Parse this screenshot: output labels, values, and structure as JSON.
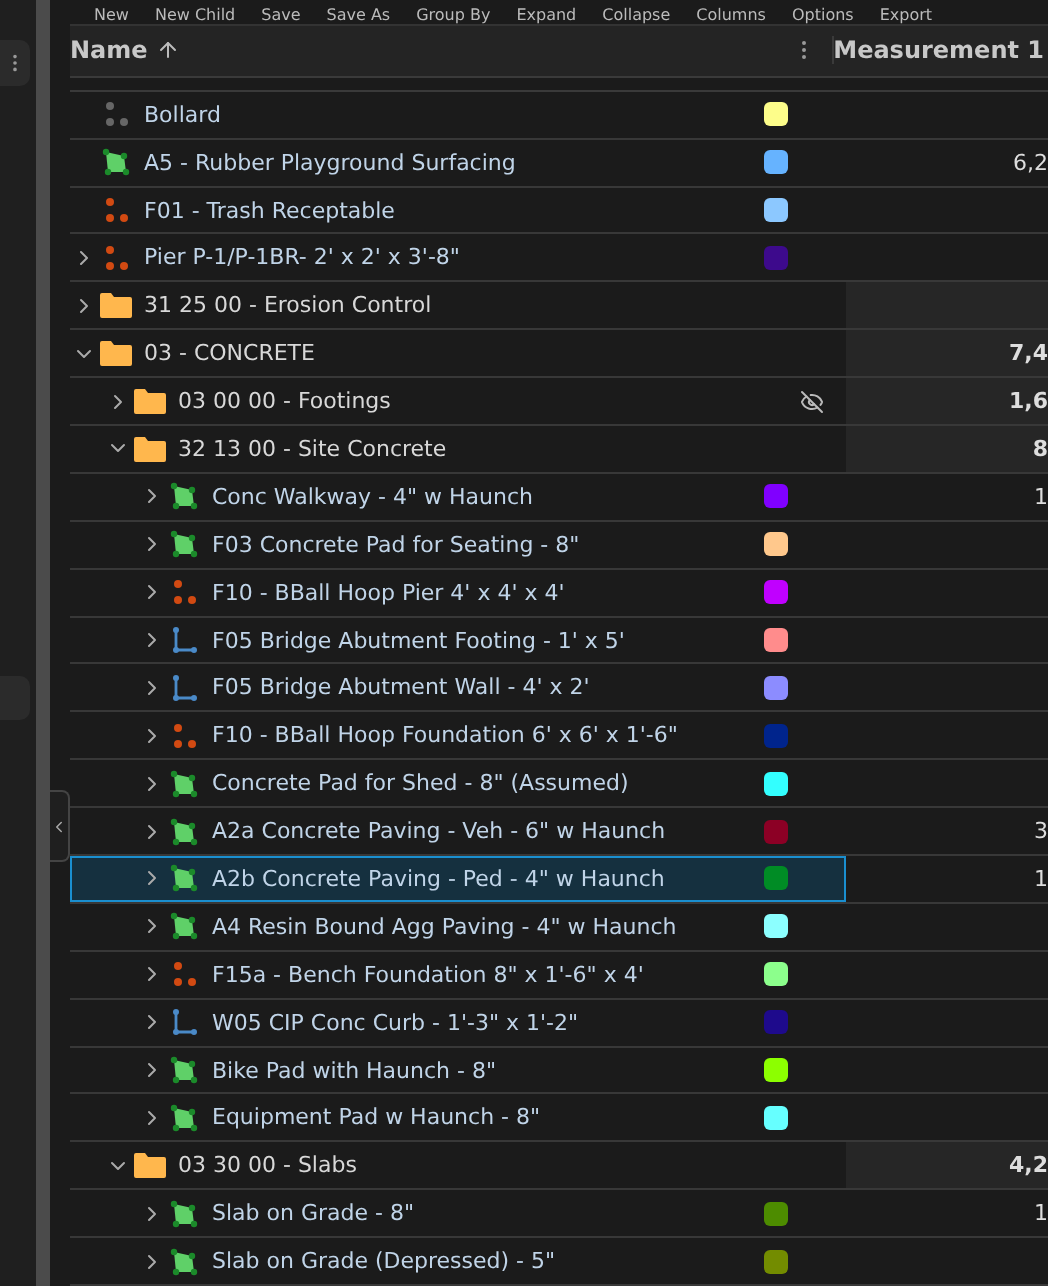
{
  "toolbar": [
    "New",
    "New Child",
    "Save",
    "Save As",
    "Group By",
    "Expand",
    "Collapse",
    "Columns",
    "Options",
    "Export"
  ],
  "columns": [
    {
      "label": "Name"
    },
    {
      "label": "Measurement 1"
    }
  ],
  "rows": [
    {
      "name": "Bollard",
      "kind": "points-muted",
      "color": "#fdfd8a",
      "hidden": false,
      "selected": false
    },
    {
      "name": "A5 - Rubber Playground Surfacing",
      "kind": "area",
      "color": "#66b3ff",
      "measurement": "6,2",
      "hidden": false,
      "selected": false
    },
    {
      "name": "F01 - Trash Receptable",
      "kind": "points",
      "color": "#8cc8ff",
      "hidden": false,
      "selected": false
    },
    {
      "name": "Pier P-1/P-1BR- 2' x 2' x 3'-8\"",
      "kind": "points",
      "color": "#3d0a8c",
      "expanded": false,
      "hidden": false,
      "selected": false
    },
    {
      "name": "31 25 00 - Erosion Control",
      "kind": "folder",
      "expanded": false,
      "hidden": false,
      "selected": false
    },
    {
      "name": "03 - CONCRETE",
      "kind": "folder",
      "measurement": "7,4",
      "expanded": true,
      "hidden": false,
      "selected": false,
      "children": [
        {
          "name": "03 00 00 - Footings",
          "kind": "folder",
          "measurement": "1,6",
          "expanded": false,
          "hidden": true,
          "selected": false
        },
        {
          "name": "32 13 00 - Site Concrete",
          "kind": "folder",
          "measurement": "8",
          "expanded": true,
          "hidden": false,
          "selected": false,
          "children": [
            {
              "name": "Conc Walkway - 4\" w Haunch",
              "kind": "area",
              "color": "#8000ff",
              "measurement": "1",
              "expanded": false,
              "hidden": false,
              "selected": false
            },
            {
              "name": "F03 Concrete Pad for Seating - 8\"",
              "kind": "area",
              "color": "#ffc88c",
              "expanded": false,
              "hidden": false,
              "selected": false
            },
            {
              "name": "F10 - BBall Hoop Pier 4' x 4' x 4'",
              "kind": "points",
              "color": "#c000ff",
              "expanded": false,
              "hidden": false,
              "selected": false
            },
            {
              "name": "F05 Bridge Abutment Footing - 1' x 5'",
              "kind": "line",
              "color": "#ff8c8c",
              "expanded": false,
              "hidden": false,
              "selected": false
            },
            {
              "name": "F05 Bridge Abutment Wall - 4' x 2'",
              "kind": "line",
              "color": "#8c8cff",
              "expanded": false,
              "hidden": false,
              "selected": false
            },
            {
              "name": "F10 - BBall Hoop Foundation 6' x 6' x 1'-6\"",
              "kind": "points",
              "color": "#00248c",
              "expanded": false,
              "hidden": false,
              "selected": false
            },
            {
              "name": "Concrete Pad for Shed - 8\" (Assumed)",
              "kind": "area",
              "color": "#33ffff",
              "expanded": false,
              "hidden": false,
              "selected": false
            },
            {
              "name": "A2a Concrete Paving - Veh - 6\" w Haunch",
              "kind": "area",
              "color": "#8c0025",
              "measurement": "3",
              "expanded": false,
              "hidden": false,
              "selected": false
            },
            {
              "name": "A2b Concrete Paving - Ped - 4\" w Haunch",
              "kind": "area",
              "color": "#008c25",
              "measurement": "1",
              "expanded": false,
              "hidden": false,
              "selected": true
            },
            {
              "name": "A4 Resin Bound Agg Paving - 4\" w Haunch",
              "kind": "area",
              "color": "#8cffff",
              "expanded": false,
              "hidden": false,
              "selected": false
            },
            {
              "name": "F15a - Bench Foundation 8\" x 1'-6\" x 4'",
              "kind": "points",
              "color": "#8cff8c",
              "expanded": false,
              "hidden": false,
              "selected": false
            },
            {
              "name": "W05 CIP Conc Curb - 1'-3\" x 1'-2\"",
              "kind": "line",
              "color": "#1e0a8c",
              "expanded": false,
              "hidden": false,
              "selected": false
            },
            {
              "name": "Bike Pad with Haunch - 8\"",
              "kind": "area",
              "color": "#8cff00",
              "expanded": false,
              "hidden": false,
              "selected": false
            },
            {
              "name": "Equipment Pad w Haunch - 8\"",
              "kind": "area",
              "color": "#66ffff",
              "expanded": false,
              "hidden": false,
              "selected": false
            }
          ]
        },
        {
          "name": "03 30 00 - Slabs",
          "kind": "folder",
          "measurement": "4,2",
          "expanded": true,
          "hidden": false,
          "selected": false,
          "children": [
            {
              "name": "Slab on Grade - 8\"",
              "kind": "area",
              "color": "#4d8c00",
              "measurement": "1",
              "expanded": false,
              "hidden": false,
              "selected": false
            },
            {
              "name": "Slab on Grade (Depressed) - 5\"",
              "kind": "area",
              "color": "#738c00",
              "expanded": false,
              "hidden": false,
              "selected": false
            }
          ]
        }
      ]
    }
  ]
}
